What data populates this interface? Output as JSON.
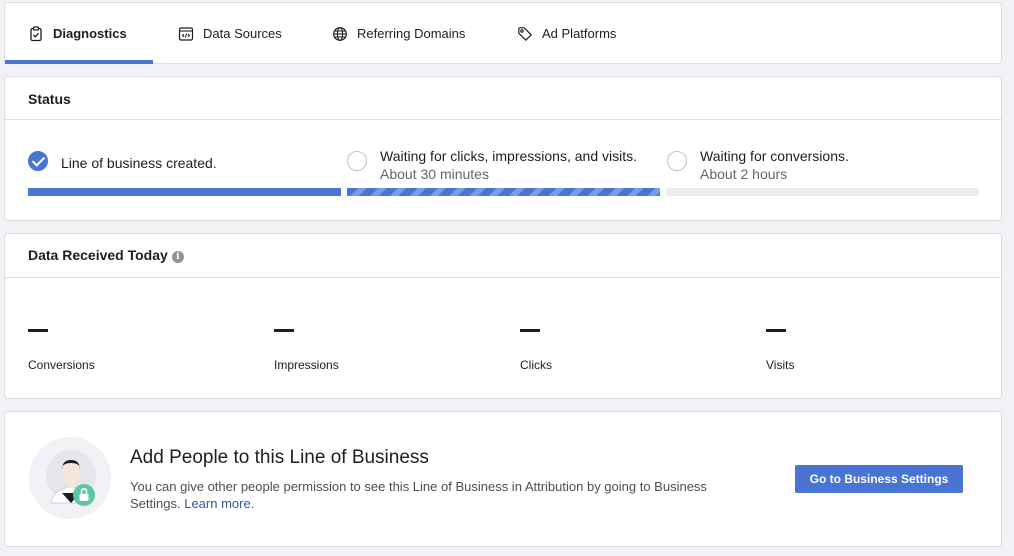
{
  "tabs": [
    {
      "label": "Diagnostics",
      "icon": "clipboard-check-icon",
      "active": true
    },
    {
      "label": "Data Sources",
      "icon": "code-window-icon",
      "active": false
    },
    {
      "label": "Referring Domains",
      "icon": "globe-icon",
      "active": false
    },
    {
      "label": "Ad Platforms",
      "icon": "tag-icon",
      "active": false
    }
  ],
  "status": {
    "title": "Status",
    "steps": [
      {
        "label": "Line of business created.",
        "sublabel": "",
        "done": true,
        "progress": 1.0
      },
      {
        "label": "Waiting for clicks, impressions, and visits.",
        "sublabel": "About 30 minutes",
        "done": false,
        "progress": 1.0
      },
      {
        "label": "Waiting for conversions.",
        "sublabel": "About 2 hours",
        "done": false,
        "progress": 0.0
      }
    ]
  },
  "received": {
    "title": "Data Received Today",
    "info_icon": "i",
    "metrics": [
      {
        "value": "—",
        "label": "Conversions"
      },
      {
        "value": "—",
        "label": "Impressions"
      },
      {
        "value": "—",
        "label": "Clicks"
      },
      {
        "value": "—",
        "label": "Visits"
      }
    ]
  },
  "people": {
    "title": "Add People to this Line of Business",
    "description": "You can give other people permission to see this Line of Business in Attribution by going to Business Settings.",
    "link": "Learn more.",
    "button": "Go to Business Settings"
  },
  "colors": {
    "accent": "#4a74d4",
    "lock_badge": "#5ec6a2"
  }
}
